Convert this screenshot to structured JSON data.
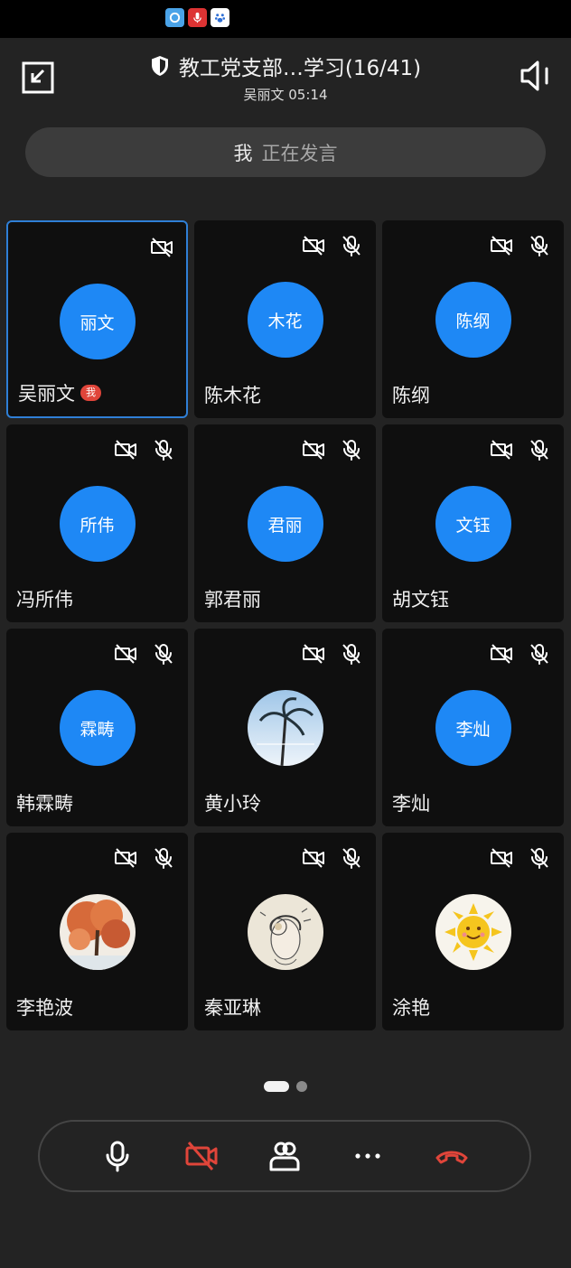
{
  "statusbar": {
    "icons": [
      "app-icon",
      "mic-indicator-icon",
      "paw-app-icon"
    ]
  },
  "header": {
    "title": "教工党支部…学习(16/41)",
    "subtitle": "吴丽文 05:14",
    "icons": [
      "shrink-window-icon",
      "shield-icon",
      "speaker-icon"
    ]
  },
  "speaking": {
    "me": "我",
    "text": "正在发言"
  },
  "participants": [
    {
      "name": "吴丽文",
      "avatar_text": "丽文",
      "badge": "我",
      "camera_off": true,
      "mic_muted": false,
      "active": true
    },
    {
      "name": "陈木花",
      "avatar_text": "木花",
      "camera_off": true,
      "mic_muted": true
    },
    {
      "name": "陈纲",
      "avatar_text": "陈纲",
      "camera_off": true,
      "mic_muted": true
    },
    {
      "name": "冯所伟",
      "avatar_text": "所伟",
      "camera_off": true,
      "mic_muted": true
    },
    {
      "name": "郭君丽",
      "avatar_text": "君丽",
      "camera_off": true,
      "mic_muted": true
    },
    {
      "name": "胡文钰",
      "avatar_text": "文钰",
      "camera_off": true,
      "mic_muted": true
    },
    {
      "name": "韩霖畴",
      "avatar_text": "霖畴",
      "camera_off": true,
      "mic_muted": true
    },
    {
      "name": "黄小玲",
      "avatar_text": "",
      "avatar_image": "sky-palm-photo",
      "camera_off": true,
      "mic_muted": true
    },
    {
      "name": "李灿",
      "avatar_text": "李灿",
      "camera_off": true,
      "mic_muted": true
    },
    {
      "name": "李艳波",
      "avatar_text": "",
      "avatar_image": "autumn-tree-photo",
      "camera_off": true,
      "mic_muted": true
    },
    {
      "name": "秦亚琳",
      "avatar_text": "",
      "avatar_image": "flower-portrait-sketch",
      "camera_off": true,
      "mic_muted": true
    },
    {
      "name": "涂艳",
      "avatar_text": "",
      "avatar_image": "sun-emoji",
      "camera_off": true,
      "mic_muted": true
    }
  ],
  "pager": {
    "pages": 2,
    "current": 1
  },
  "controls": [
    "microphone-icon",
    "camera-off-icon",
    "participants-icon",
    "more-icon",
    "hang-up-icon"
  ],
  "colors": {
    "avatar_blue": "#1e88f5",
    "active_border": "#2f7fd6",
    "hangup_red": "#e0453a",
    "me_badge": "#e0453a"
  }
}
